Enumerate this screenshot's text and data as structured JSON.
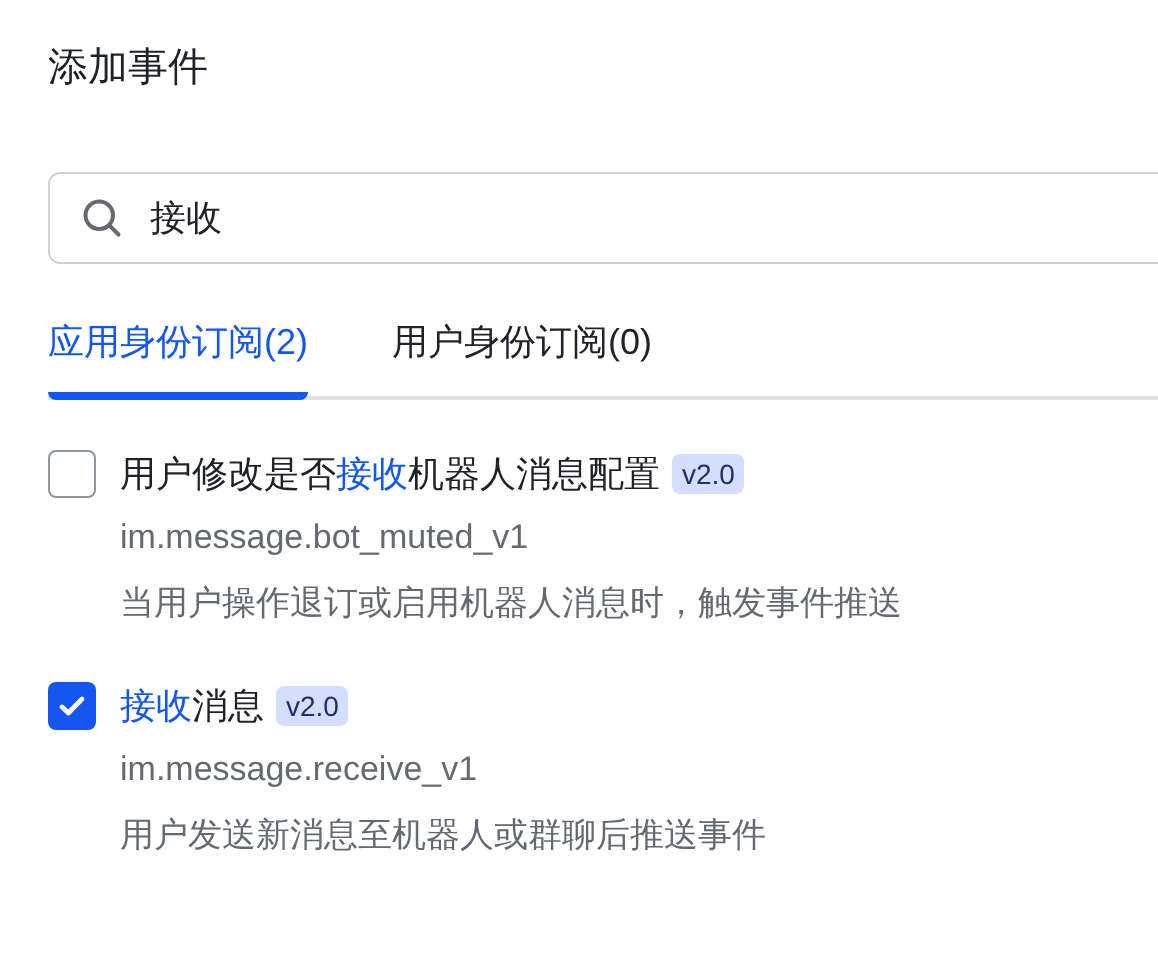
{
  "title": "添加事件",
  "search": {
    "value": "接收"
  },
  "tabs": [
    {
      "label": "应用身份订阅(2)",
      "selected": true
    },
    {
      "label": "用户身份订阅(0)",
      "selected": false
    }
  ],
  "events": [
    {
      "checked": false,
      "title": [
        {
          "text": "用户修改是否",
          "highlight": false
        },
        {
          "text": "接收",
          "highlight": true
        },
        {
          "text": "机器人消息配置",
          "highlight": false
        }
      ],
      "version": "v2.0",
      "key": "im.message.bot_muted_v1",
      "description": "当用户操作退订或启用机器人消息时，触发事件推送"
    },
    {
      "checked": true,
      "title": [
        {
          "text": "接收",
          "highlight": true
        },
        {
          "text": "消息",
          "highlight": false
        }
      ],
      "version": "v2.0",
      "key": "im.message.receive_v1",
      "description": "用户发送新消息至机器人或群聊后推送事件"
    }
  ]
}
